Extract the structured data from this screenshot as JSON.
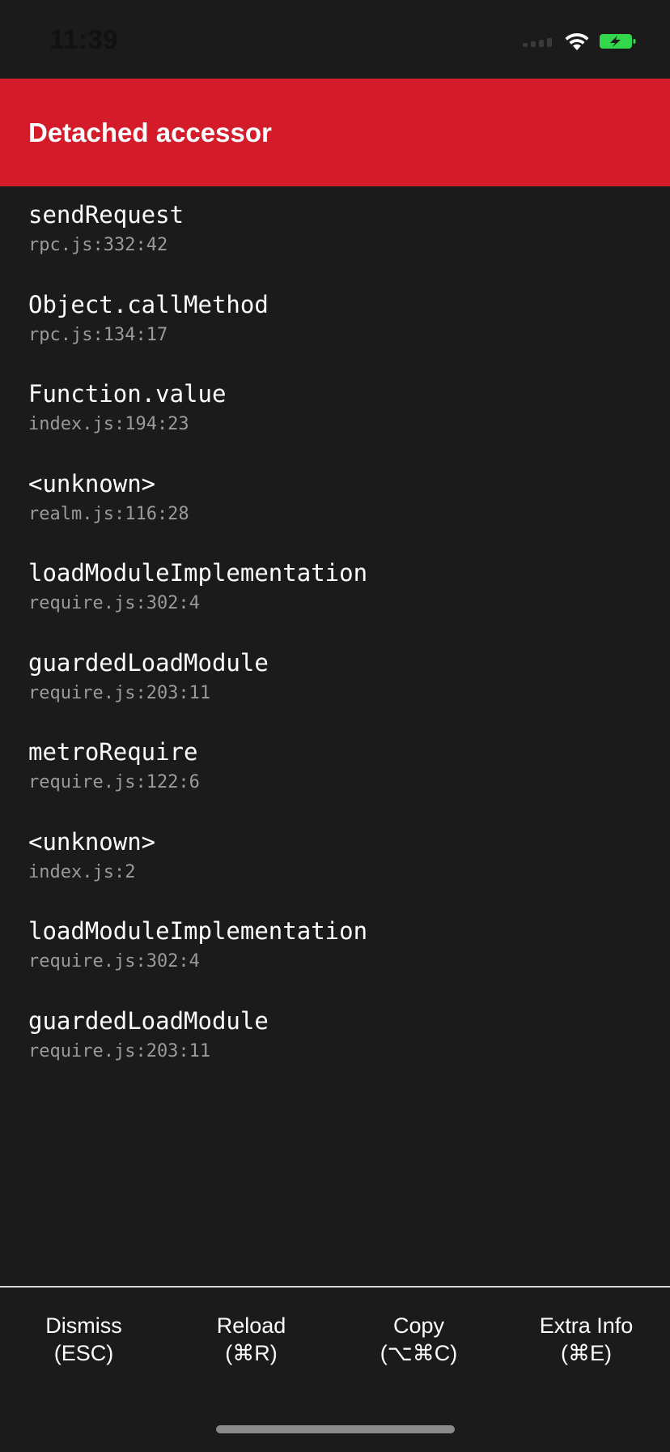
{
  "status_bar": {
    "time": "11:39",
    "icons": [
      "cellular-signal-icon",
      "wifi-icon",
      "battery-charging-icon"
    ],
    "battery_color": "#32d74b"
  },
  "header": {
    "title": "Detached accessor",
    "background_color": "#d41b29"
  },
  "stack": [
    {
      "method": "sendRequest",
      "location": "rpc.js:332:42"
    },
    {
      "method": "Object.callMethod",
      "location": "rpc.js:134:17"
    },
    {
      "method": "Function.value",
      "location": "index.js:194:23"
    },
    {
      "method": "<unknown>",
      "location": "realm.js:116:28"
    },
    {
      "method": "loadModuleImplementation",
      "location": "require.js:302:4"
    },
    {
      "method": "guardedLoadModule",
      "location": "require.js:203:11"
    },
    {
      "method": "metroRequire",
      "location": "require.js:122:6"
    },
    {
      "method": "<unknown>",
      "location": "index.js:2"
    },
    {
      "method": "loadModuleImplementation",
      "location": "require.js:302:4"
    },
    {
      "method": "guardedLoadModule",
      "location": "require.js:203:11"
    }
  ],
  "footer": {
    "buttons": [
      {
        "label": "Dismiss",
        "shortcut": "(ESC)"
      },
      {
        "label": "Reload",
        "shortcut": "(⌘R)"
      },
      {
        "label": "Copy",
        "shortcut": "(⌥⌘C)"
      },
      {
        "label": "Extra Info",
        "shortcut": "(⌘E)"
      }
    ]
  }
}
